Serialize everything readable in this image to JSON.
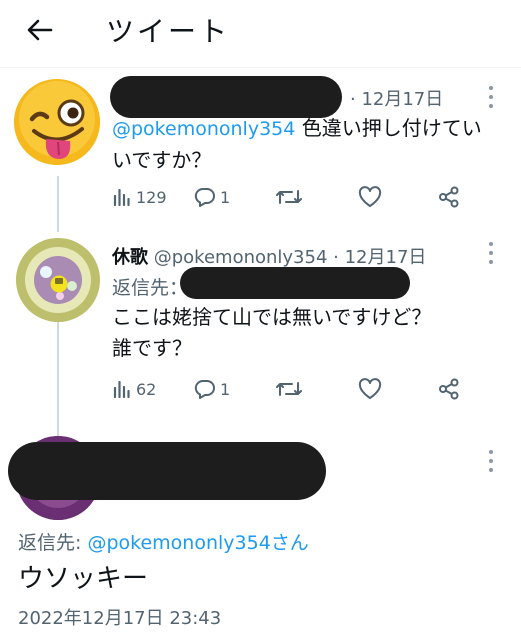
{
  "header": {
    "title": "ツイート",
    "back_icon": "arrow-left-icon"
  },
  "tweets": [
    {
      "name": "",
      "handle": "",
      "date_sep": "· 12月17日",
      "reply_to": "@pokemononly354",
      "text_line1": "色違い押し付けてい",
      "text_line2": "いですか？",
      "stats": {
        "views": "129",
        "replies": "1",
        "retweets": "",
        "likes": ""
      },
      "avatar_icon": "winking-tongue-emoji-icon"
    },
    {
      "name": "休歌",
      "handle": "@pokemononly354",
      "date_sep": "· 12月17日",
      "reply_label": "返信先：",
      "text_line1": "ここは姥捨て山では無いですけど？",
      "text_line2": "誰です？",
      "stats": {
        "views": "62",
        "replies": "1",
        "retweets": "",
        "likes": ""
      },
      "avatar_icon": "gem-avatar-icon"
    }
  ],
  "focus_tweet": {
    "reply_label": "返信先: ",
    "reply_handle": "@pokemononly354さん",
    "text": "ウソッキー",
    "timestamp": "2022年12月17日 23:43"
  },
  "colors": {
    "link": "#1d9bf0",
    "muted": "#536471",
    "text": "#0f1419",
    "redaction": "#1d1d1d"
  }
}
